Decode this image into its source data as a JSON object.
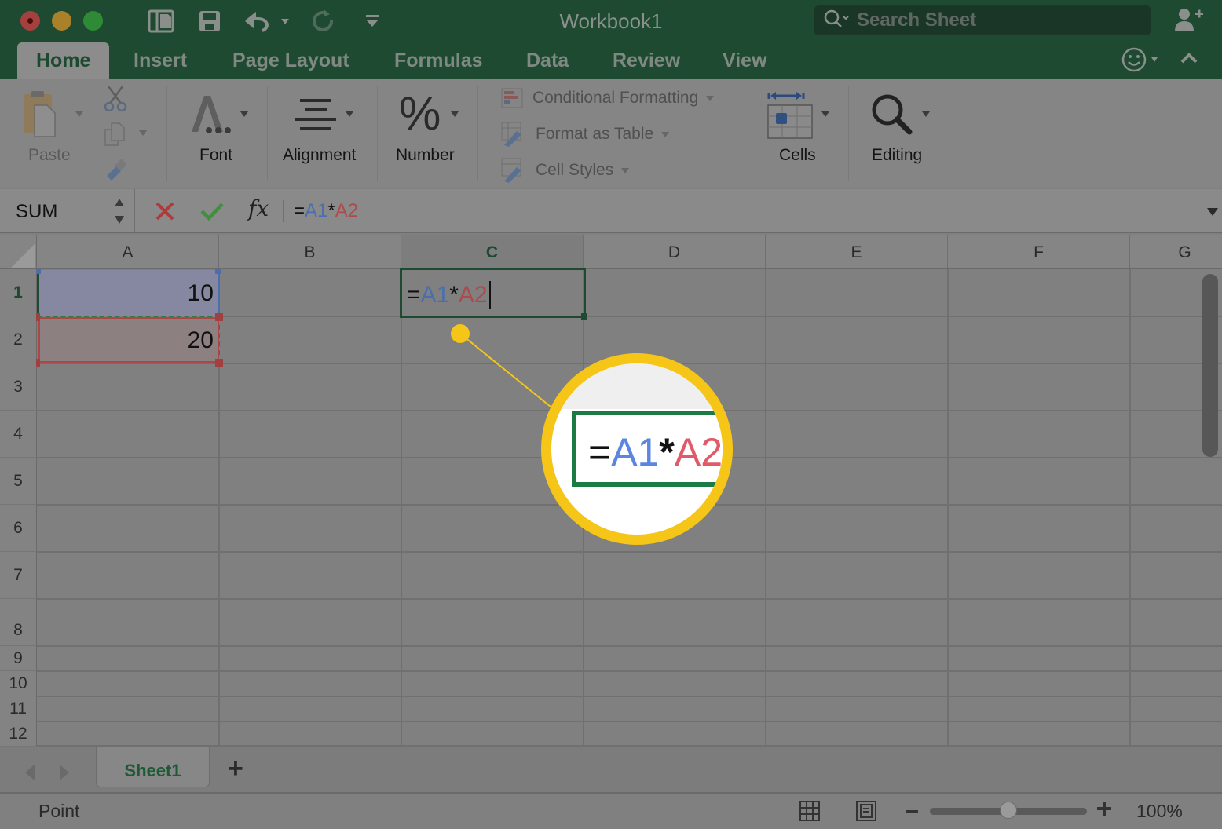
{
  "window": {
    "title": "Workbook1",
    "search_placeholder": "Search Sheet"
  },
  "tabs": [
    {
      "label": "Home",
      "active": true
    },
    {
      "label": "Insert"
    },
    {
      "label": "Page Layout"
    },
    {
      "label": "Formulas"
    },
    {
      "label": "Data"
    },
    {
      "label": "Review"
    },
    {
      "label": "View"
    }
  ],
  "ribbon": {
    "paste": "Paste",
    "font": "Font",
    "alignment": "Alignment",
    "number": "Number",
    "number_glyph": "%",
    "conditional_formatting": "Conditional Formatting",
    "format_as_table": "Format as Table",
    "cell_styles": "Cell Styles",
    "cells": "Cells",
    "editing": "Editing"
  },
  "formula_bar": {
    "name_box": "SUM",
    "fx_label": "fx",
    "formula_eq": "=",
    "formula_ref1": "A1",
    "formula_op": "*",
    "formula_ref2": "A2"
  },
  "grid": {
    "columns": [
      "A",
      "B",
      "C",
      "D",
      "E",
      "F",
      "G"
    ],
    "selected_column": "C",
    "rows": [
      "1",
      "2",
      "3",
      "4",
      "5",
      "6",
      "7",
      "8",
      "9",
      "10",
      "11",
      "12"
    ],
    "selected_row": "1",
    "cells": {
      "A1": "10",
      "A2": "20",
      "C1_eq": "=",
      "C1_ref1": "A1",
      "C1_op": "*",
      "C1_ref2": "A2"
    }
  },
  "callout": {
    "eq": "=",
    "ref1": "A1",
    "op": "*",
    "ref2": "A2"
  },
  "sheets": {
    "tabs": [
      "Sheet1"
    ],
    "add_label": "+"
  },
  "status": {
    "mode": "Point",
    "zoom_label": "100%",
    "zoom_value": 100
  },
  "colors": {
    "accent_green": "#1d4a31",
    "ref1_blue": "#4a6fb0",
    "ref2_red": "#b04a4a",
    "callout_yellow": "#f5c518",
    "cancel_red": "#b03a3a",
    "enter_green": "#3f8f3f"
  }
}
